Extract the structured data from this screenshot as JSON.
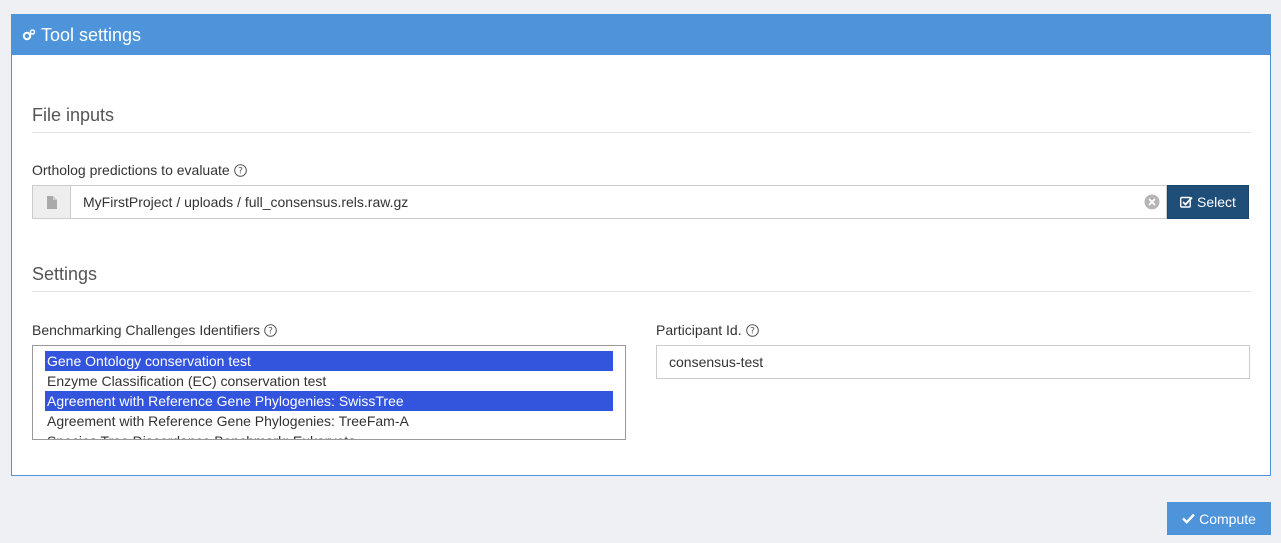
{
  "panel": {
    "title": "Tool settings",
    "icon": "gears-icon",
    "accent_color": "#4d94db"
  },
  "file_inputs": {
    "section_title": "File inputs",
    "ortholog_label": "Ortholog predictions to evaluate",
    "file_path": "MyFirstProject / uploads / full_consensus.rels.raw.gz",
    "select_label": "Select"
  },
  "settings": {
    "section_title": "Settings",
    "challenges_label": "Benchmarking Challenges Identifiers",
    "challenges": [
      {
        "label": "Gene Ontology conservation test",
        "selected": true
      },
      {
        "label": "Enzyme Classification (EC) conservation test",
        "selected": false
      },
      {
        "label": "Agreement with Reference Gene Phylogenies: SwissTree",
        "selected": true
      },
      {
        "label": "Agreement with Reference Gene Phylogenies: TreeFam-A",
        "selected": false
      },
      {
        "label": "Species Tree Discordance Benchmark: Eukaryota",
        "selected": false
      }
    ],
    "participant_label": "Participant Id.",
    "participant_value": "consensus-test"
  },
  "footer": {
    "compute_label": "Compute"
  }
}
